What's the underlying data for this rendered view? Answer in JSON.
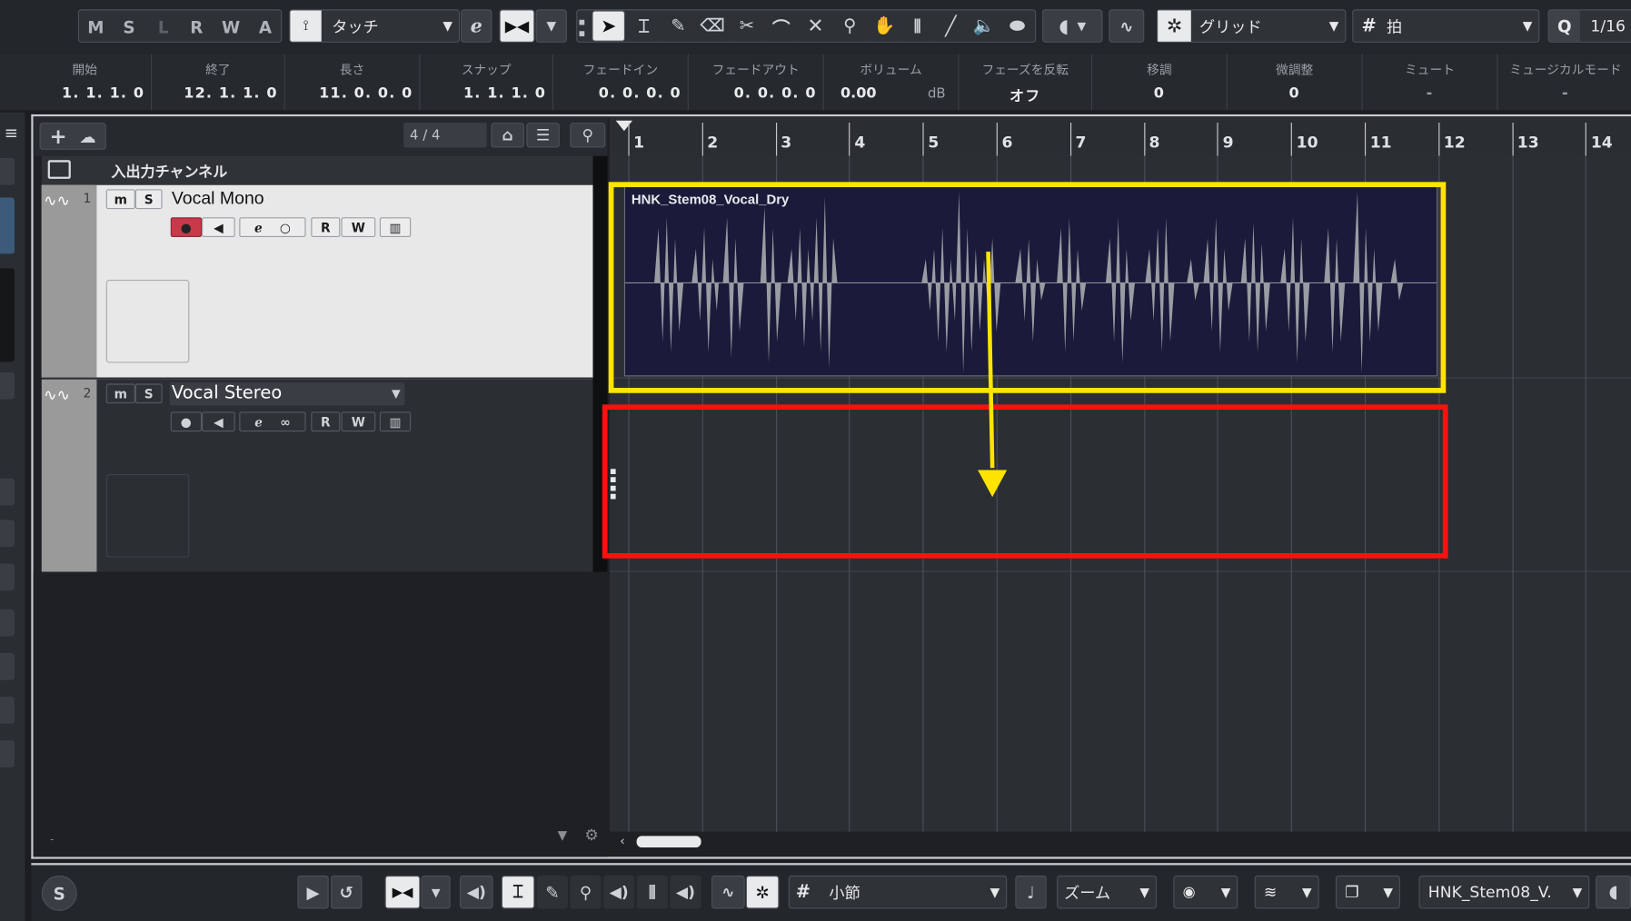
{
  "toolbar": {
    "ms_letters": [
      "M",
      "S",
      "L",
      "R",
      "W",
      "A"
    ],
    "automation_mode": "タッチ",
    "snap_type": "グリッド",
    "grid_type": "拍",
    "quantize": "1/16"
  },
  "infoline": [
    {
      "label": "開始",
      "value": "1.  1.  1.    0"
    },
    {
      "label": "終了",
      "value": "12.  1.  1.    0"
    },
    {
      "label": "長さ",
      "value": "11.  0.  0.    0"
    },
    {
      "label": "スナップ",
      "value": "1.  1.  1.    0"
    },
    {
      "label": "フェードイン",
      "value": "0.  0.  0.    0"
    },
    {
      "label": "フェードアウト",
      "value": "0.  0.  0.    0"
    },
    {
      "label": "ボリューム",
      "value": "0.00",
      "unit": "dB"
    },
    {
      "label": "フェーズを反転",
      "value": "オフ"
    },
    {
      "label": "移調",
      "value": "0"
    },
    {
      "label": "微調整",
      "value": "0"
    },
    {
      "label": "ミュート",
      "value": "-"
    },
    {
      "label": "ミュージカルモード",
      "value": "-"
    }
  ],
  "tracklist": {
    "counter": "4 / 4",
    "folder_label": "入出力チャンネル",
    "tracks": [
      {
        "number": "1",
        "name": "Vocal Mono",
        "m": "m",
        "s": "S",
        "r": "R",
        "w": "W"
      },
      {
        "number": "2",
        "name": "Vocal Stereo",
        "m": "m",
        "s": "S",
        "r": "R",
        "w": "W"
      }
    ]
  },
  "ruler": {
    "bars": [
      "1",
      "2",
      "3",
      "4",
      "5",
      "6",
      "7",
      "8",
      "9",
      "10",
      "11",
      "12",
      "13",
      "14"
    ]
  },
  "event": {
    "name": "HNK_Stem08_Vocal_Dry"
  },
  "bottombar": {
    "ruler_format": "小節",
    "zoom_label": "ズーム",
    "event_select": "HNK_Stem08_V."
  },
  "colors": {
    "highlight_yellow": "#ffe400",
    "highlight_red": "#ff1010",
    "record": "#c8394a"
  }
}
